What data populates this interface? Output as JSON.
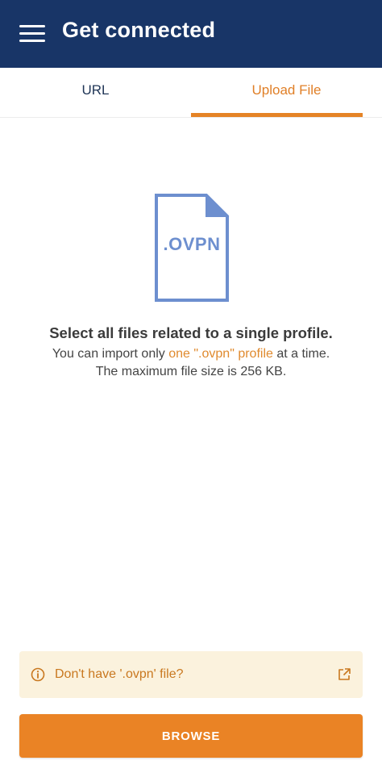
{
  "header": {
    "title": "Get connected",
    "menu_icon": "hamburger-menu-icon",
    "background": "#183567"
  },
  "tabs": [
    {
      "label": "URL",
      "active": false
    },
    {
      "label": "Upload File",
      "active": true
    }
  ],
  "file_graphic": {
    "icon": "ovpn-file-icon",
    "label": ".OVPN",
    "color": "#6d8fcf"
  },
  "content": {
    "headline": "Select all files related to a single profile.",
    "line1_prefix": "You can import only ",
    "line1_highlight": "one \".ovpn\" profile",
    "line1_suffix": " at a time.",
    "line2": "The maximum file size is 256 KB."
  },
  "notice": {
    "icon": "info-icon",
    "text": "Don't have '.ovpn' file?",
    "link_icon": "external-link-icon"
  },
  "browse_button": {
    "label": "BROWSE",
    "color": "#ea8325"
  },
  "colors": {
    "accent": "#e58326",
    "notice_bg": "#fbf2dd"
  }
}
